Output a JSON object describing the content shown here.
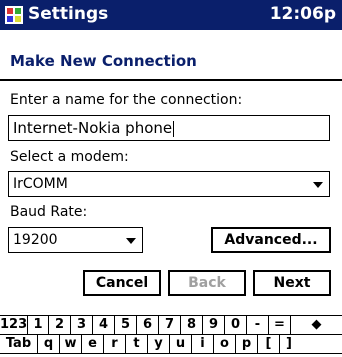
{
  "titlebar": {
    "title": "Settings",
    "clock": "12:06p"
  },
  "subheader": {
    "text": "Make New Connection"
  },
  "form": {
    "name_label": "Enter a name for the connection:",
    "name_value": "Internet-Nokia phone",
    "modem_label": "Select a modem:",
    "modem_value": "IrCOMM",
    "baud_label": "Baud Rate:",
    "baud_value": "19200",
    "advanced_label": "Advanced..."
  },
  "buttons": {
    "cancel": "Cancel",
    "back": "Back",
    "next": "Next"
  },
  "keyboard": {
    "row1": [
      "123",
      "1",
      "2",
      "3",
      "4",
      "5",
      "6",
      "7",
      "8",
      "9",
      "0",
      "-",
      "=",
      "◆"
    ],
    "row2": [
      "Tab",
      "q",
      "w",
      "e",
      "r",
      "t",
      "y",
      "u",
      "i",
      "o",
      "p",
      "[",
      "]"
    ]
  }
}
